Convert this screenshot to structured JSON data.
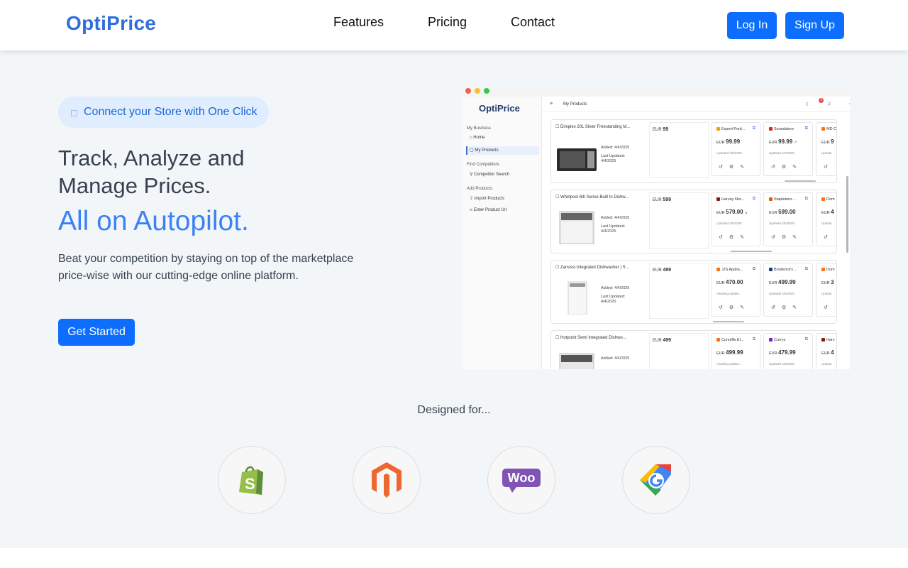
{
  "header": {
    "brand": "OptiPrice",
    "nav": [
      "Features",
      "Pricing",
      "Contact"
    ],
    "login": "Log In",
    "signup": "Sign Up"
  },
  "hero": {
    "pill": "Connect your Store with One Click",
    "heading_line1": "Track, Analyze and",
    "heading_line2": "Manage Prices.",
    "accent": "All on Autopilot.",
    "desc_line1": "Beat your competition by staying on top of the marketplace",
    "desc_line2": "price-wise with our cutting-edge online platform.",
    "cta": "Get Started"
  },
  "app": {
    "brand": "OptiPrice",
    "page_title": "My Products",
    "notif_count": "1",
    "sections": {
      "business": "My Business",
      "home": "Home",
      "products": "My Products",
      "find": "Find Competitors",
      "search": "Competitor Search",
      "add": "Add Products",
      "import": "Import Products",
      "enter": "Enter Product Url"
    },
    "rows": [
      {
        "title": "Dimplex 20L Silver Freestanding M...",
        "added": "Added: 4/4/2025",
        "last1": "Last Updated:",
        "last2": "4/4/2025",
        "currency": "EUR",
        "price": "99",
        "comps": [
          {
            "name": "Expert Porti...",
            "currency": "EUR",
            "price": "99.99",
            "updated": "Updated 4/5/2025",
            "trend": ""
          },
          {
            "name": "Soundstore",
            "currency": "EUR",
            "price": "99.99",
            "updated": "Updated 4/7/2025",
            "trend": "↗"
          },
          {
            "name": "MD C",
            "currency": "EUR",
            "price": "9",
            "updated": "Update",
            "trend": ""
          }
        ]
      },
      {
        "title": "Whirlpool 6th Sense Built In Dishw...",
        "added": "Added: 4/4/2025",
        "last1": "Last Updated:",
        "last2": "4/4/2025",
        "currency": "EUR",
        "price": "599",
        "comps": [
          {
            "name": "Harvey Nor...",
            "currency": "EUR",
            "price": "579.00",
            "updated": "Updated 4/5/2025",
            "trend": "↘"
          },
          {
            "name": "Stapletons ...",
            "currency": "EUR",
            "price": "599.00",
            "updated": "Updated 4/5/2025",
            "trend": ""
          },
          {
            "name": "Dom",
            "currency": "EUR",
            "price": "4",
            "updated": "Update",
            "trend": ""
          }
        ]
      },
      {
        "title": "Zanussi Integrated Dishwasher | S...",
        "added": "Added: 4/4/2025",
        "last1": "Last Updated:",
        "last2": "4/4/2025",
        "currency": "EUR",
        "price": "499",
        "comps": [
          {
            "name": "JJS Applia...",
            "currency": "EUR",
            "price": "470.00",
            "updated": "Awaiting update...",
            "trend": ""
          },
          {
            "name": "Broderick's ...",
            "currency": "EUR",
            "price": "499.99",
            "updated": "Updated 4/5/2025",
            "trend": ""
          },
          {
            "name": "Dom",
            "currency": "EUR",
            "price": "3",
            "updated": "Update",
            "trend": ""
          }
        ]
      },
      {
        "title": "Hotpoint Semi Integrated Dishwo...",
        "added": "Added: 4/4/2025",
        "last1": "",
        "last2": "",
        "currency": "EUR",
        "price": "499",
        "comps": [
          {
            "name": "Cunniffe El...",
            "currency": "EUR",
            "price": "499.99",
            "updated": "Awaiting update...",
            "trend": ""
          },
          {
            "name": "Currys",
            "currency": "EUR",
            "price": "479.99",
            "updated": "Updated 4/5/2025",
            "trend": ""
          },
          {
            "name": "Harv",
            "currency": "EUR",
            "price": "4",
            "updated": "Update",
            "trend": ""
          }
        ]
      }
    ]
  },
  "designed_for": {
    "label": "Designed for...",
    "logos": [
      "shopify-icon",
      "magento-icon",
      "woocommerce-icon",
      "google-shopping-icon"
    ],
    "woo_text": "Woo"
  },
  "colors": {
    "primary": "#0d6efd",
    "brand": "#2f6fdc",
    "accent": "#3b82f6",
    "background": "#f3f6f9"
  }
}
